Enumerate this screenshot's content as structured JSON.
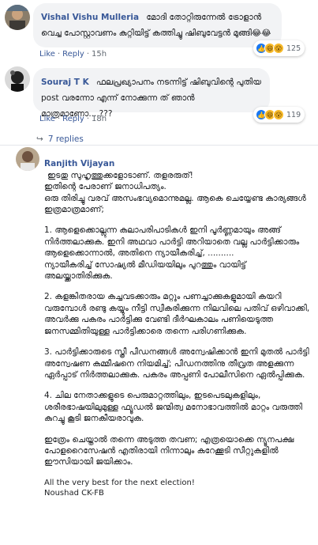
{
  "comments": [
    {
      "author": "Vishal Vishu Mulleria",
      "text": "മോദി തോറ്റിരുന്നേൽ ട്രോളാൻ വെച്ച പോസ്റ്റാവണം കുറ്റിയിട്ട് കത്തിച്ചു ഷിബുവേട്ടൻ മുങ്ങി😂😂",
      "like": "Like",
      "reply": "Reply",
      "time": "15h",
      "reaction_count": "125"
    },
    {
      "author": "Souraj T K",
      "text": "ഫലപ്രഖ്യാപനം നടന്നിട്ട് ഷിബുവിന്റെ പുതിയ post വരന്നോ എന്ന് നോക്കുന്ന ത് ഞാൻ മാത്രമാണോ....???",
      "like": "Like",
      "reply": "Reply",
      "time": "18h",
      "reaction_count": "119"
    }
  ],
  "replies_link": "7 replies",
  "main_comment": {
    "author": "Ranjith Vijayan",
    "intro": "ഇടതു സുഹൃത്തുക്കളോടാണ്. തളരരുത്!",
    "p1": "ഇതിന്റെ പേരാണ് ജനാധിപത്യം.\nഒരു തിരിച്ചു വരവ് അസംഭവ്യമൊന്നുമല്ല. ആകെ ചെയ്യേണ്ട കാര്യങ്ങൾ ഇത്രമാത്രമാണ്;",
    "p2": "1. ആളെക്കൊല്ലുന്ന കലാപരിപാടികൾ ഇനി പൂർണ്ണമായും അങ്ങ് നിർത്തലാക്കുക. ഇനി അഥവാ പാർട്ടി അറിയാതെ വല്ല പാർട്ടിക്കാരും ആളെക്കൊന്നാൽ, അതിനെ ന്യായീകരിച്ച്, ..........\nന്യായീകരിച്ച് സോഷ്യൽ മീഡിയയിലും പുറത്തും വായിട്ട് അലയ്ക്കാതിരിക്കുക.",
    "p3": "2. കളങ്കിതരായ കച്ചവടക്കാരും മറ്റും പണച്ചാക്കുകളുമായി കയറി വരുമ്പോൾ രണ്ടു കയ്യും നീട്ടി സ്വീകരിക്കുന്ന നിലവിലെ പതിവ് ഒഴിവാക്കി, അവർക്കു പകരം പാർട്ടിക്കു വേണ്ടി ദീർഘകാലം പണിയെടുത്ത ജനസമ്മിതിയുള്ള പാർട്ടിക്കാരെ തന്നെ പരിഗണിക്കുക.",
    "p4": "3. പാർട്ടിക്കാരുടെ സ്ത്രീ പീഡനങ്ങൾ അന്വേഷിക്കാൻ ഇനി മുതൽ പാർട്ടി അന്വേഷണ കമ്മീഷനെ നിയമിച്ച്; പീഡനത്തിനു തീവ്രത അളക്കുന്ന ഏർപ്പാട് നിർത്തലാക്കുക. പകരം അപ്പണി പോലീസിനെ ഏൽപ്പിക്കുക.",
    "p5": "4. ചില നേതാക്കളുടെ പെരുമാറ്റത്തിലും, ഇടപെടലുകളിലും, ശരീരഭാഷയിലുമുള്ള ഫ്യൂഡൽ ജന്മിത്വ മനോഭാവത്തിൽ മാറ്റം വരുത്തി കുറച്ചു കൂടി ജനകീയരാവുക.",
    "p6": "ഇത്രേം ചെയ്താൽ തന്നെ അടുത്ത തവണ; എത്രയൊക്കെ ന്യൂനപക്ഷ പോളറൈസേഷൻ എതിരായി നിന്നാലും കുറേക്കൂടി സീറ്റുകളിൽ ഈസിയായി ജയിക്കാം.",
    "closing": "All the very best for the next election!",
    "signature": "Noushad CK-FB"
  },
  "colors": {
    "link": "#385898",
    "bubble": "#f2f3f5",
    "muted": "#606770",
    "like_blue": "#1877f2",
    "emoji_yellow": "#f7b928"
  },
  "icons": [
    "like-icon",
    "haha-icon",
    "wow-icon",
    "reply-arrow-icon"
  ]
}
